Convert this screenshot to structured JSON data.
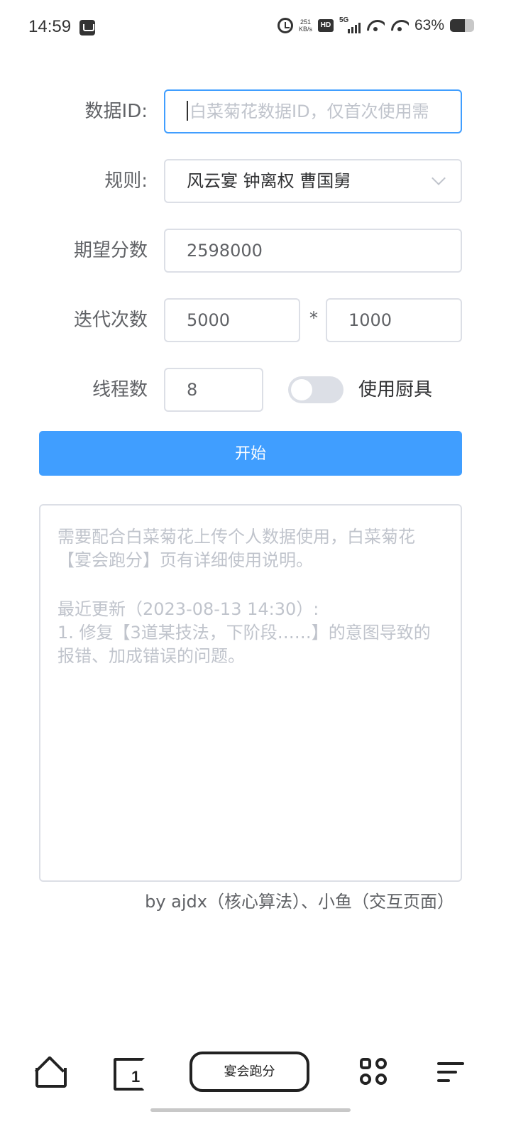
{
  "status_bar": {
    "time": "14:59",
    "net_speed_value": "251",
    "net_speed_unit": "KB/s",
    "hd_label": "HD",
    "network_label": "5G",
    "battery_text": "63%",
    "battery_level": 0.63
  },
  "form": {
    "data_id": {
      "label": "数据ID:",
      "placeholder": "白菜菊花数据ID，仅首次使用需"
    },
    "rule": {
      "label": "规则:",
      "value": "风云宴 钟离权 曹国舅"
    },
    "expected_score": {
      "label": "期望分数",
      "value": "2598000"
    },
    "iterations": {
      "label": "迭代次数",
      "value_a": "5000",
      "multiplier": "*",
      "value_b": "1000"
    },
    "threads": {
      "label": "线程数",
      "value": "8"
    },
    "use_tools": {
      "label": "使用厨具",
      "enabled": false
    }
  },
  "start_button": {
    "label": "开始"
  },
  "notes": {
    "line1": "需要配合白菜菊花上传个人数据使用，白菜菊花【宴会跑分】页有详细使用说明。",
    "line2": "最近更新（2023-08-13 14:30）:",
    "line3": "1. 修复【3道某技法，下阶段……】的意图导致的报错、加成错误的问题。"
  },
  "credit": "by ajdx（核心算法）、小鱼（交互页面）",
  "bottom_nav": {
    "tabs_count": "1",
    "center_label": "宴会跑分"
  },
  "colors": {
    "primary": "#409eff",
    "border": "#dcdfe6",
    "placeholder": "#c0c4cc",
    "text": "#606266"
  }
}
